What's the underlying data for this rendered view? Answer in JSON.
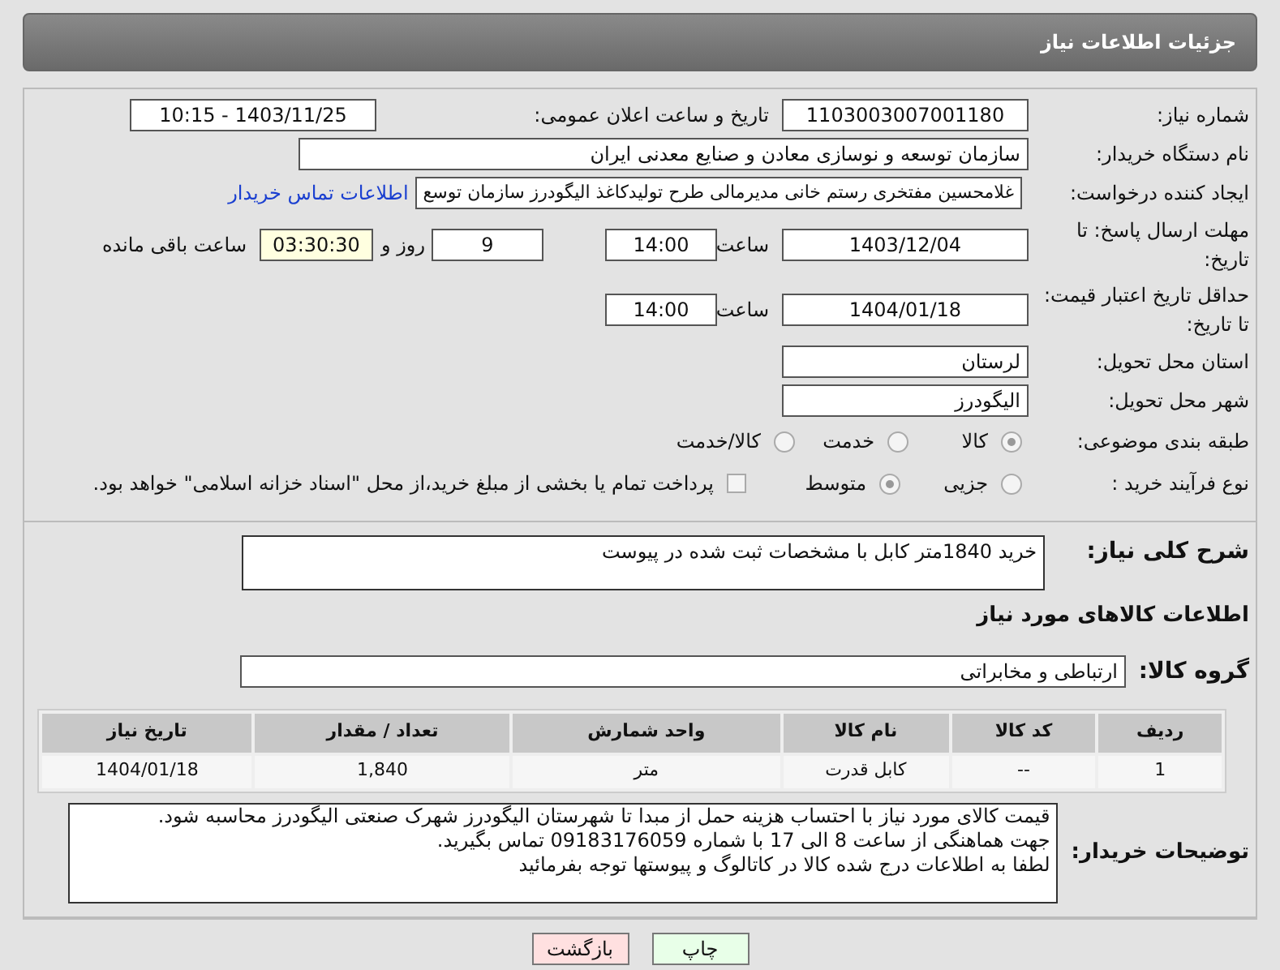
{
  "header": {
    "title": "جزئیات اطلاعات نیاز"
  },
  "need_number": {
    "label": "شماره نیاز:",
    "value": "1103003007001180"
  },
  "announce": {
    "label": "تاریخ و ساعت اعلان عمومی:",
    "value": "1403/11/25 - 10:15"
  },
  "buyer_org": {
    "label": "نام دستگاه خریدار:",
    "value": "سازمان توسعه و نوسازی معادن و صنایع معدنی ایران"
  },
  "creator": {
    "label": "ایجاد کننده درخواست:",
    "value": "غلامحسین مفتخری رستم خانی مدیرمالی طرح تولیدکاغذ الیگودرز سازمان توسع",
    "link": "اطلاعات تماس خریدار"
  },
  "reply_deadline": {
    "label": "مهلت ارسال پاسخ: تا تاریخ:",
    "date": "1403/12/04",
    "time_label": "ساعت",
    "time": "14:00",
    "days": "9",
    "days_label": "روز و",
    "remaining": "03:30:30",
    "remaining_label": "ساعت باقی مانده"
  },
  "price_validity": {
    "label": "حداقل تاریخ اعتبار قیمت: تا تاریخ:",
    "date": "1404/01/18",
    "time_label": "ساعت",
    "time": "14:00"
  },
  "province": {
    "label": "استان محل تحویل:",
    "value": "لرستان"
  },
  "city": {
    "label": "شهر محل تحویل:",
    "value": "الیگودرز"
  },
  "category": {
    "label": "طبقه بندی موضوعی:",
    "options": [
      {
        "label": "کالا",
        "selected": true
      },
      {
        "label": "خدمت",
        "selected": false
      },
      {
        "label": "کالا/خدمت",
        "selected": false
      }
    ]
  },
  "process": {
    "label": "نوع فرآیند خرید :",
    "options": [
      {
        "label": "جزیی",
        "selected": false
      },
      {
        "label": "متوسط",
        "selected": true
      }
    ],
    "payment": {
      "checked": false,
      "label": "پرداخت تمام یا بخشی از مبلغ خرید،از محل \"اسناد خزانه اسلامی\" خواهد بود."
    }
  },
  "description": {
    "label": "شرح کلی نیاز:",
    "value": "خرید 1840متر کابل با مشخصات ثبت شده در پیوست"
  },
  "goods_title": "اطلاعات کالاهای مورد نیاز",
  "goods_group": {
    "label": "گروه کالا:",
    "value": "ارتباطی و مخابراتی"
  },
  "table": {
    "columns": [
      "ردیف",
      "کد کالا",
      "نام کالا",
      "واحد شمارش",
      "تعداد / مقدار",
      "تاریخ نیاز"
    ],
    "rows": [
      [
        "1",
        "--",
        "کابل قدرت",
        "متر",
        "1,840",
        "1404/01/18"
      ]
    ]
  },
  "buyer_notes": {
    "label": "توضیحات خریدار:",
    "lines": [
      "قیمت کالای مورد نیاز با احتساب هزینه حمل از مبدا تا شهرستان الیگودرز شهرک صنعتی الیگودرز محاسبه شود.",
      "جهت هماهنگی از ساعت 8 الی 17 با شماره 09183176059 تماس بگیرید.",
      "لطفا به اطلاعات درج شده کالا در کاتالوگ و پیوستها توجه بفرمائید"
    ]
  },
  "buttons": [
    {
      "label": "چاپ",
      "kind": "print"
    },
    {
      "label": "بازگشت",
      "kind": "back"
    }
  ]
}
